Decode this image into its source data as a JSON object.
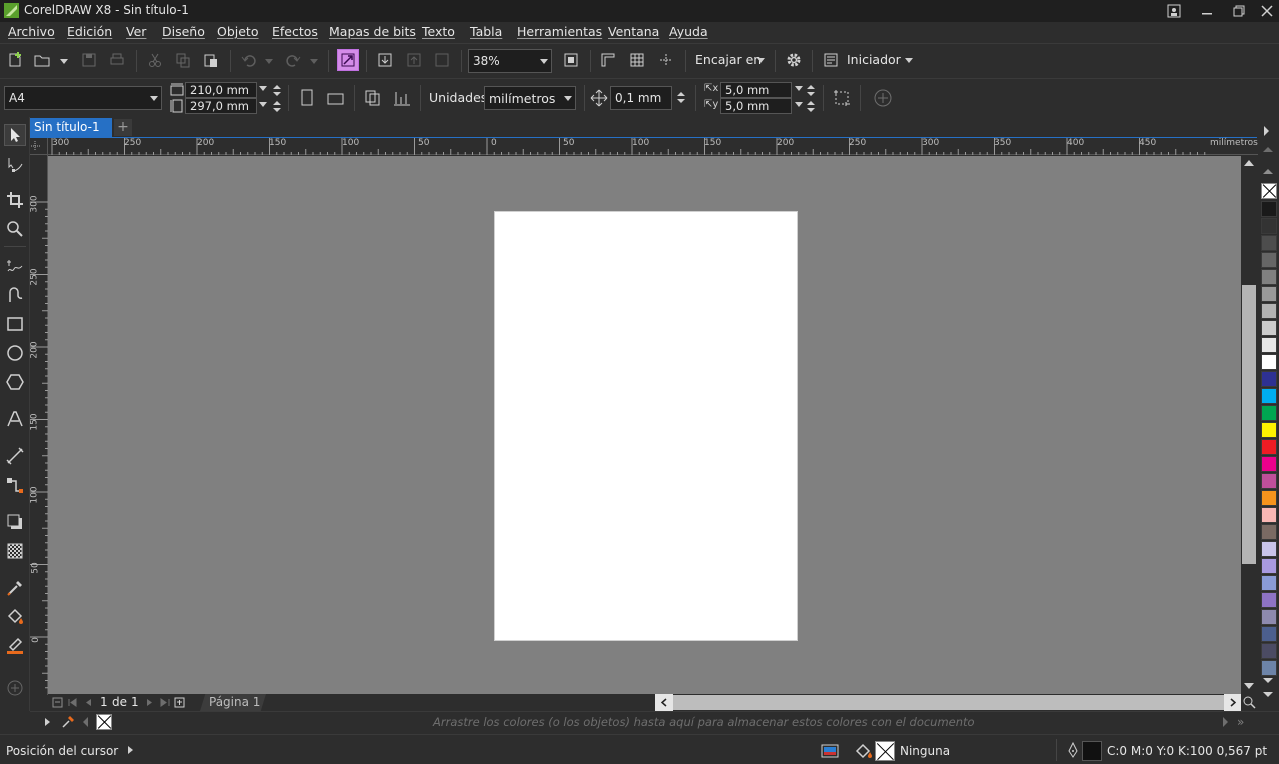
{
  "window": {
    "title": "CorelDRAW X8 - Sin título-1"
  },
  "menu": [
    "Archivo",
    "Edición",
    "Ver",
    "Diseño",
    "Objeto",
    "Efectos",
    "Mapas de bits",
    "Texto",
    "Tabla",
    "Herramientas",
    "Ventana",
    "Ayuda"
  ],
  "standard_toolbar": {
    "zoom": "38%",
    "snap_label": "Encajar en",
    "launcher_label": "Iniciador"
  },
  "property_bar": {
    "page_size": "A4",
    "width": "210,0 mm",
    "height": "297,0 mm",
    "units_label": "Unidades:",
    "units_value": "milímetros",
    "nudge": "0,1 mm",
    "dup_x": "5,0 mm",
    "dup_y": "5,0 mm"
  },
  "tabs": {
    "document": "Sin título-1"
  },
  "rulers": {
    "h_labels": [
      "300",
      "250",
      "200",
      "150",
      "100",
      "50",
      "0",
      "50",
      "100",
      "150",
      "200",
      "250",
      "300",
      "350",
      "400",
      "450"
    ],
    "h_unit": "milímetros",
    "v_labels": [
      "300",
      "250",
      "200",
      "150",
      "100",
      "50",
      "0"
    ]
  },
  "page_nav": {
    "current": "1",
    "of": "de",
    "total": "1",
    "page_tab": "Página 1"
  },
  "document_palette": {
    "hint": "Arrastre los colores (o los objetos) hasta aquí para almacenar estos colores con el documento"
  },
  "status": {
    "cursor_label": "Posición del cursor",
    "fill_label": "Ninguna",
    "outline_label": "C:0 M:0 Y:0 K:100  0,567 pt"
  },
  "palette_colors": [
    "#1a1a1a",
    "#333333",
    "#4d4d4d",
    "#666666",
    "#808080",
    "#999999",
    "#b3b3b3",
    "#cccccc",
    "#e6e6e6",
    "#ffffff",
    "#2e3192",
    "#00aeef",
    "#00a651",
    "#fff200",
    "#ed1c24",
    "#ec008c",
    "#bf4f9a",
    "#f7941d",
    "#f9b7b4",
    "#7a6a63",
    "#c9c4ea",
    "#a99ae0",
    "#8a9bd6",
    "#8e73c4",
    "#8e8aae",
    "#4c5f8e",
    "#4b4b63",
    "#6d84a8"
  ]
}
